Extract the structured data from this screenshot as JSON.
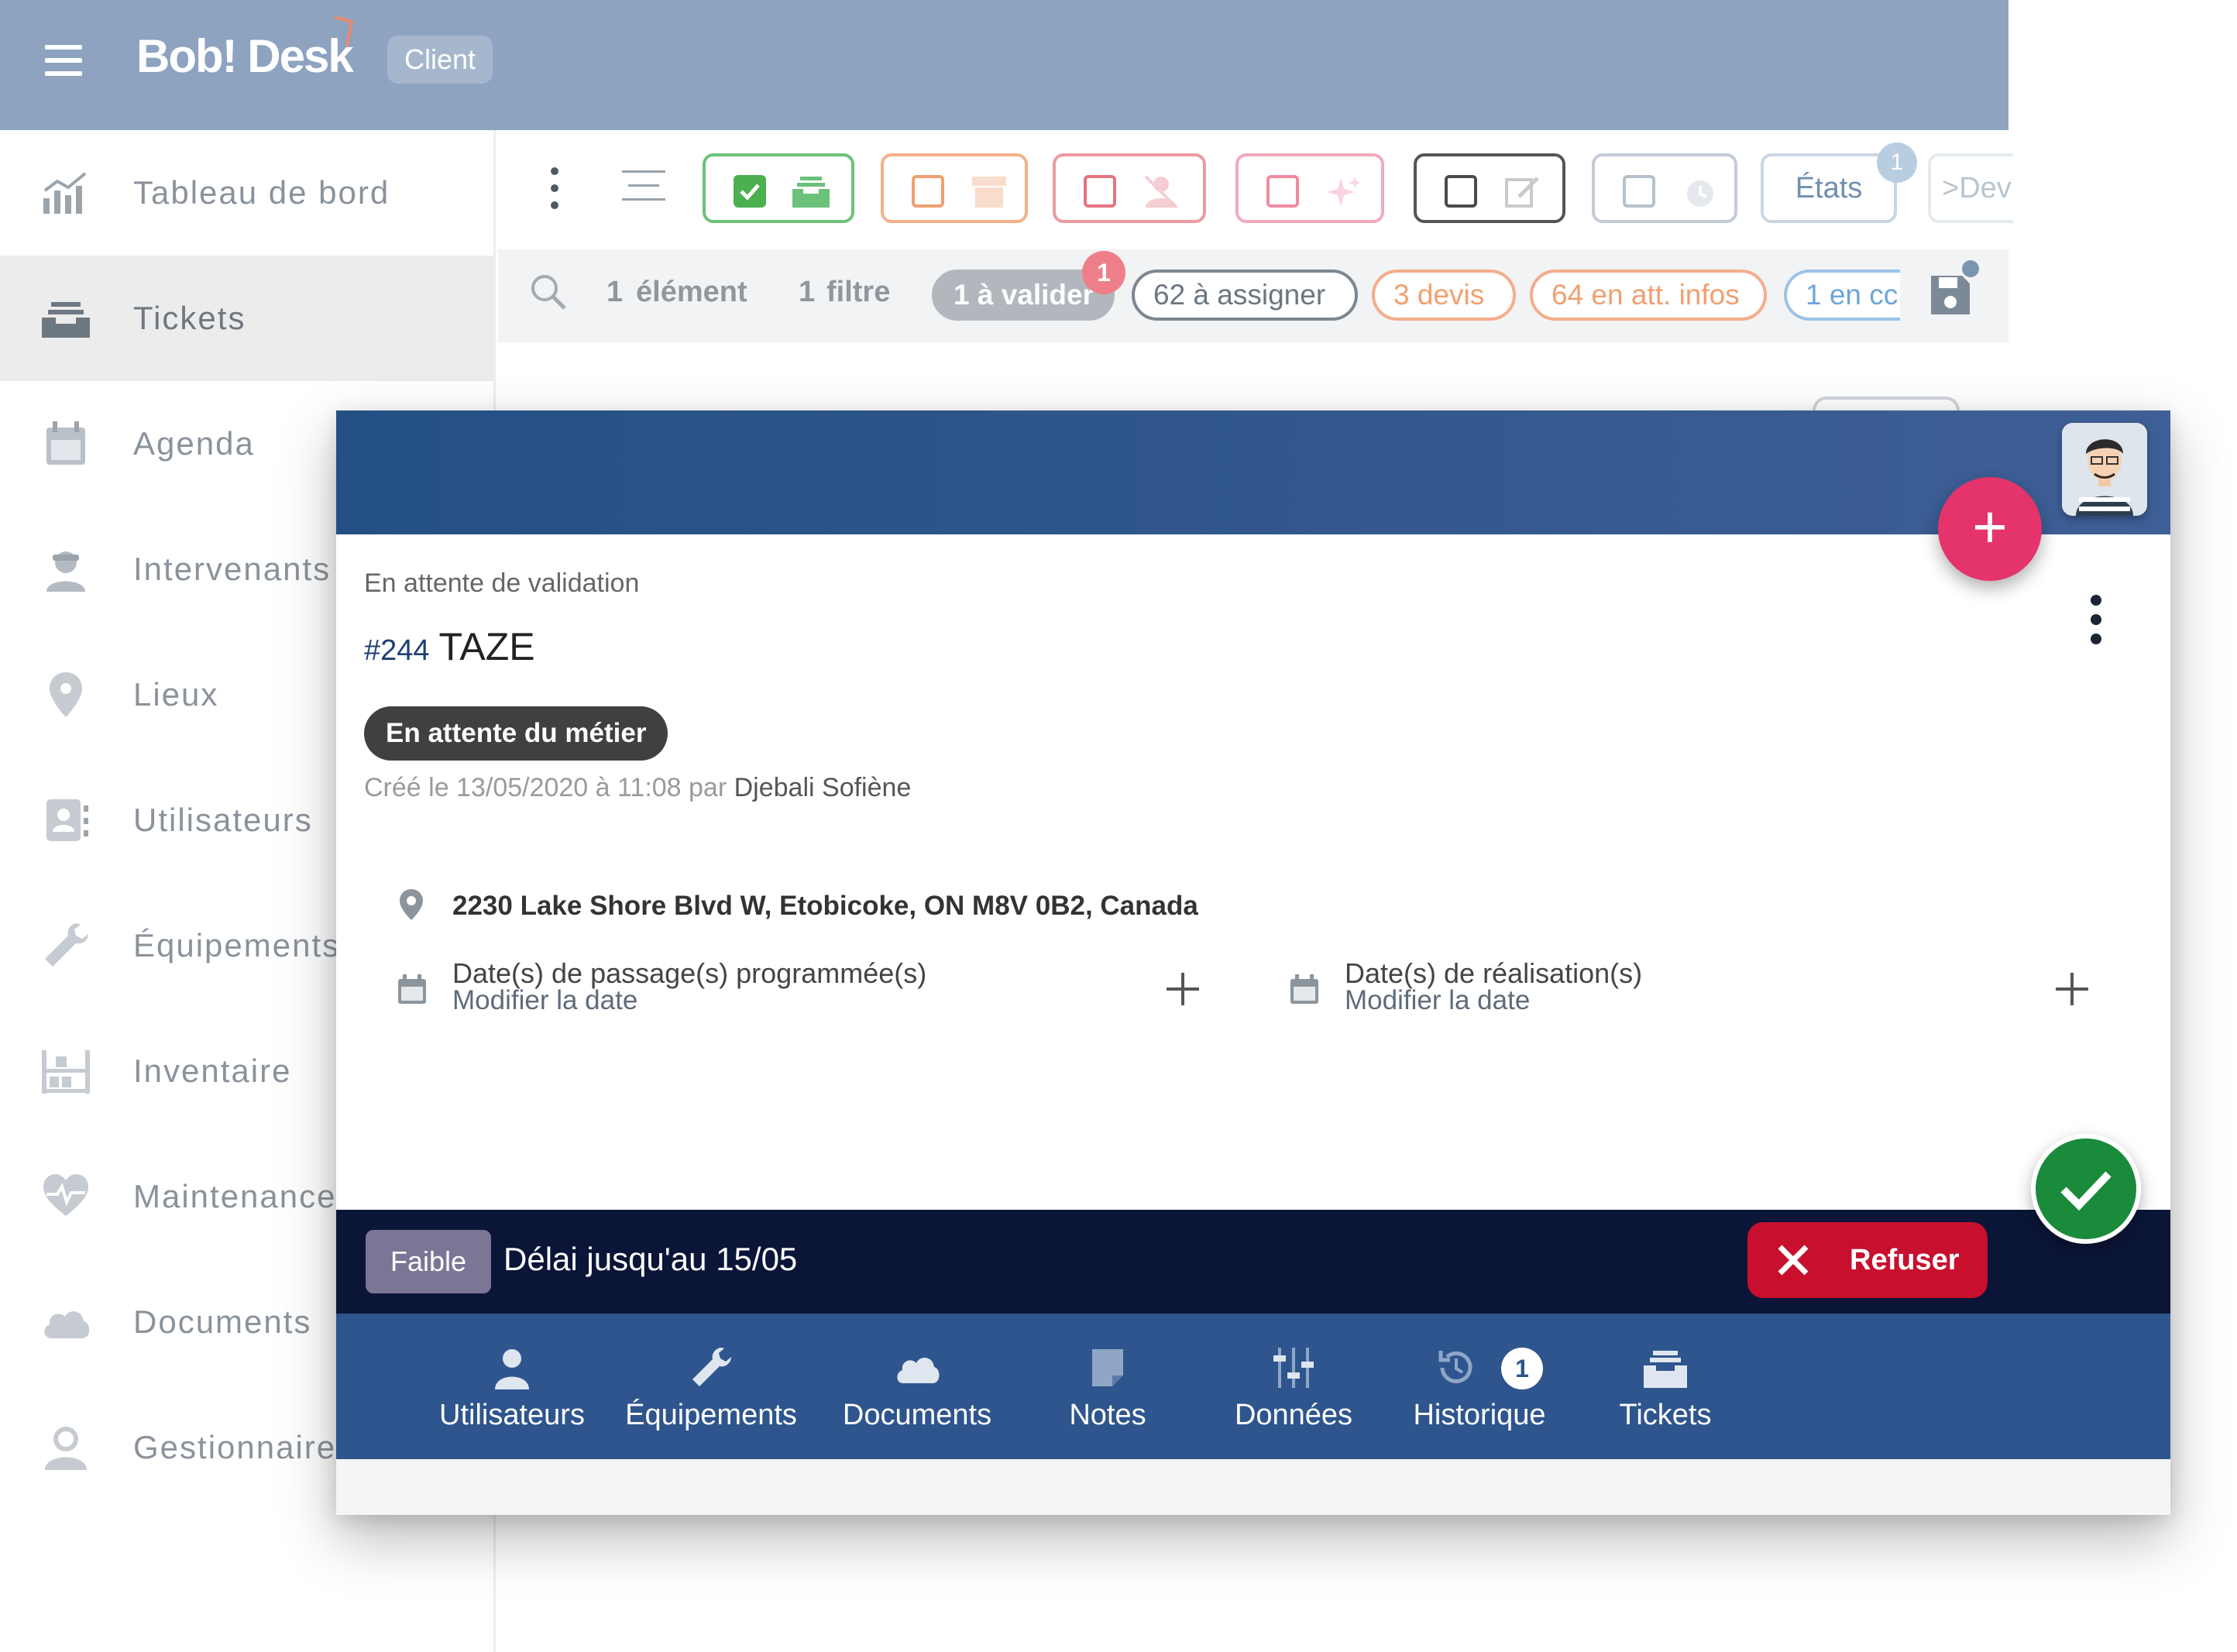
{
  "app": {
    "logo": "Bob! Desk",
    "role_badge": "Client"
  },
  "sidebar": {
    "items": [
      {
        "label": "Tableau de bord",
        "icon": "dashboard-chart-icon"
      },
      {
        "label": "Tickets",
        "icon": "inbox-tray-icon",
        "active": true
      },
      {
        "label": "Agenda",
        "icon": "calendar-icon"
      },
      {
        "label": "Intervenants",
        "icon": "worker-icon"
      },
      {
        "label": "Lieux",
        "icon": "location-pin-icon"
      },
      {
        "label": "Utilisateurs",
        "icon": "contact-card-icon"
      },
      {
        "label": "Équipements",
        "icon": "wrench-icon"
      },
      {
        "label": "Inventaire",
        "icon": "inventory-icon"
      },
      {
        "label": "Maintenances",
        "icon": "heartbeat-icon"
      },
      {
        "label": "Documents",
        "icon": "cloud-icon"
      },
      {
        "label": "Gestionnaires",
        "icon": "manager-icon"
      }
    ]
  },
  "toolbar": {
    "filter_colors": [
      "#4caf50",
      "#f0a070",
      "#e57380",
      "#f08aa0",
      "#4a4a4a",
      "#b6c1cc"
    ],
    "etats_label": "États",
    "etats_count": "1",
    "dev_label": ">Dev"
  },
  "filterbar": {
    "element_count": "1",
    "element_label": "élément",
    "filter_count": "1",
    "filter_label": "filtre",
    "chips": [
      {
        "label": "1 à valider",
        "badge": "1"
      },
      {
        "label": "62 à assigner"
      },
      {
        "label": "3 devis"
      },
      {
        "label": "64 en att. infos"
      },
      {
        "label": "1 en cc"
      }
    ]
  },
  "ticket": {
    "status": "En attente de validation",
    "number": "#244",
    "title": "TAZE",
    "state": "En attente du métier",
    "created_prefix": "Créé le 13/05/2020 à 11:08 par ",
    "author": "Djebali Sofiène",
    "address": "2230 Lake Shore Blvd W, Etobicoke, ON M8V 0B2, Canada",
    "planned_label": "Date(s) de passage(s) programmée(s)",
    "planned_link": "Modifier la date",
    "done_label": "Date(s) de réalisation(s)",
    "done_link": "Modifier la date",
    "priority": "Faible",
    "deadline": "Délai jusqu'au 15/05",
    "refuse_label": "Refuser"
  },
  "tabs": [
    {
      "label": "Utilisateurs",
      "icon": "user-icon"
    },
    {
      "label": "Équipements",
      "icon": "wrench-icon"
    },
    {
      "label": "Documents",
      "icon": "cloud-icon"
    },
    {
      "label": "Notes",
      "icon": "note-icon"
    },
    {
      "label": "Données",
      "icon": "sliders-icon"
    },
    {
      "label": "Historique",
      "icon": "history-icon",
      "badge": "1"
    },
    {
      "label": "Tickets",
      "icon": "inbox-tray-icon"
    }
  ],
  "colors": {
    "topbar": "#8da3bf",
    "modal_header": "#2b5389",
    "deadline_bar": "#0b1538",
    "tabbar": "#2e558d",
    "add_fab": "#e5336b",
    "validate_fab": "#1a8a3b",
    "refuse": "#c8102e"
  }
}
